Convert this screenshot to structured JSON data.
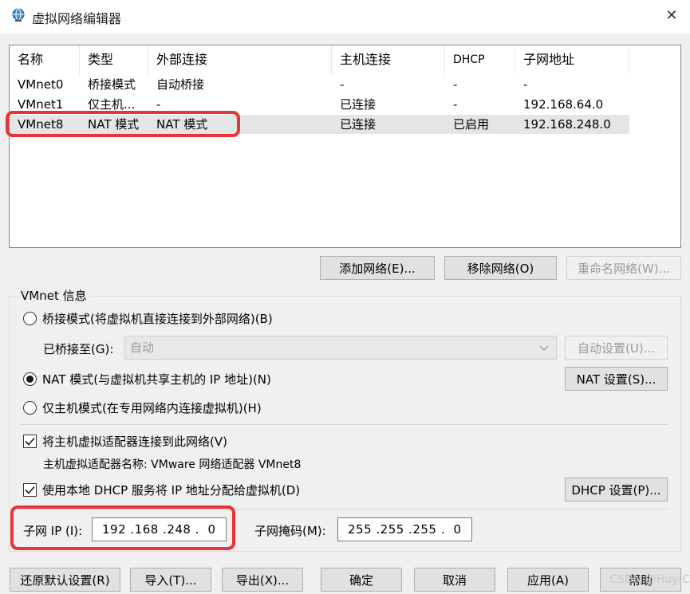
{
  "window": {
    "title": "虚拟网络编辑器",
    "icon": "globe-network-icon",
    "close": "✕"
  },
  "table": {
    "headers": [
      "名称",
      "类型",
      "外部连接",
      "主机连接",
      "DHCP",
      "子网地址"
    ],
    "rows": [
      [
        "VMnet0",
        "桥接模式",
        "自动桥接",
        "-",
        "-",
        "-"
      ],
      [
        "VMnet1",
        "仅主机...",
        "-",
        "已连接",
        "-",
        "192.168.64.0"
      ],
      [
        "VMnet8",
        "NAT 模式",
        "NAT 模式",
        "已连接",
        "已启用",
        "192.168.248.0"
      ]
    ],
    "selected_row": 2
  },
  "table_buttons": {
    "add": "添加网络(E)...",
    "remove": "移除网络(O)",
    "rename": "重命名网络(W)..."
  },
  "vmnet_info": {
    "legend": "VMnet 信息",
    "bridge_mode": "桥接模式(将虚拟机直接连接到外部网络)(B)",
    "bridged_to_label": "已桥接至(G):",
    "bridged_to_value": "自动",
    "auto_settings": "自动设置(U)...",
    "nat_mode": "NAT 模式(与虚拟机共享主机的 IP 地址)(N)",
    "nat_settings": "NAT 设置(S)...",
    "host_only_mode": "仅主机模式(在专用网络内连接虚拟机)(H)",
    "connect_adapter": "将主机虚拟适配器连接到此网络(V)",
    "adapter_name": "主机虚拟适配器名称: VMware 网络适配器 VMnet8",
    "use_dhcp": "使用本地 DHCP 服务将 IP 地址分配给虚拟机(D)",
    "dhcp_settings": "DHCP 设置(P)...",
    "subnet_ip_label": "子网 IP (I):",
    "subnet_ip_value": "192 .168 .248 .  0",
    "subnet_mask_label": "子网掩码(M):",
    "subnet_mask_value": "255 .255 .255 .  0",
    "selected_mode": "nat",
    "connect_adapter_checked": true,
    "use_dhcp_checked": true
  },
  "footer_buttons": {
    "restore": "还原默认设置(R)",
    "import": "导入(T)...",
    "export": "导出(X)...",
    "ok": "确定",
    "cancel": "取消",
    "apply": "应用(A)",
    "help": "帮助"
  },
  "watermark": "CSDN @Huy-C",
  "highlight_color": "#e8333a"
}
